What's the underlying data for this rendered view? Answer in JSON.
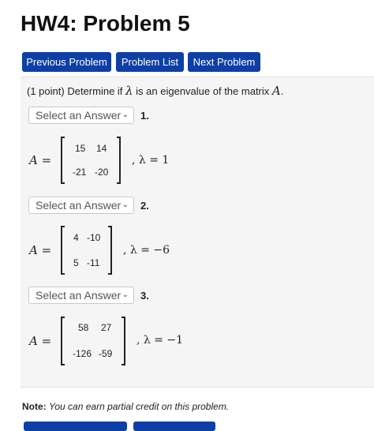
{
  "page": {
    "title": "HW4: Problem 5",
    "nav": {
      "previous": "Previous Problem",
      "list": "Problem List",
      "next": "Next Problem"
    }
  },
  "problem": {
    "points": "(1 point)",
    "prompt_before": "Determine if",
    "prompt_symbol": "λ",
    "prompt_middle": "is an eigenvalue of the matrix",
    "prompt_matrix": "A",
    "prompt_end": ".",
    "parts": [
      {
        "number": "1.",
        "select": "Select an Answer",
        "matrix_label": "A =",
        "matrix": [
          [
            "15",
            "14"
          ],
          [
            "-21",
            "-20"
          ]
        ],
        "lambda_text": ", λ = 1"
      },
      {
        "number": "2.",
        "select": "Select an Answer",
        "matrix_label": "A =",
        "matrix": [
          [
            "4",
            "-10"
          ],
          [
            "5",
            "-11"
          ]
        ],
        "lambda_text": ", λ = −6"
      },
      {
        "number": "3.",
        "select": "Select an Answer",
        "matrix_label": "A =",
        "matrix": [
          [
            "58",
            "27"
          ],
          [
            "-126",
            "-59"
          ]
        ],
        "lambda_text": ", λ = −1"
      }
    ]
  },
  "note": {
    "label": "Note:",
    "text": "You can earn partial credit on this problem."
  },
  "colors": {
    "button": "#0d3fa6",
    "panel": "#f5f5f5"
  },
  "icons": {
    "dropdown": "chevron-down-icon"
  }
}
